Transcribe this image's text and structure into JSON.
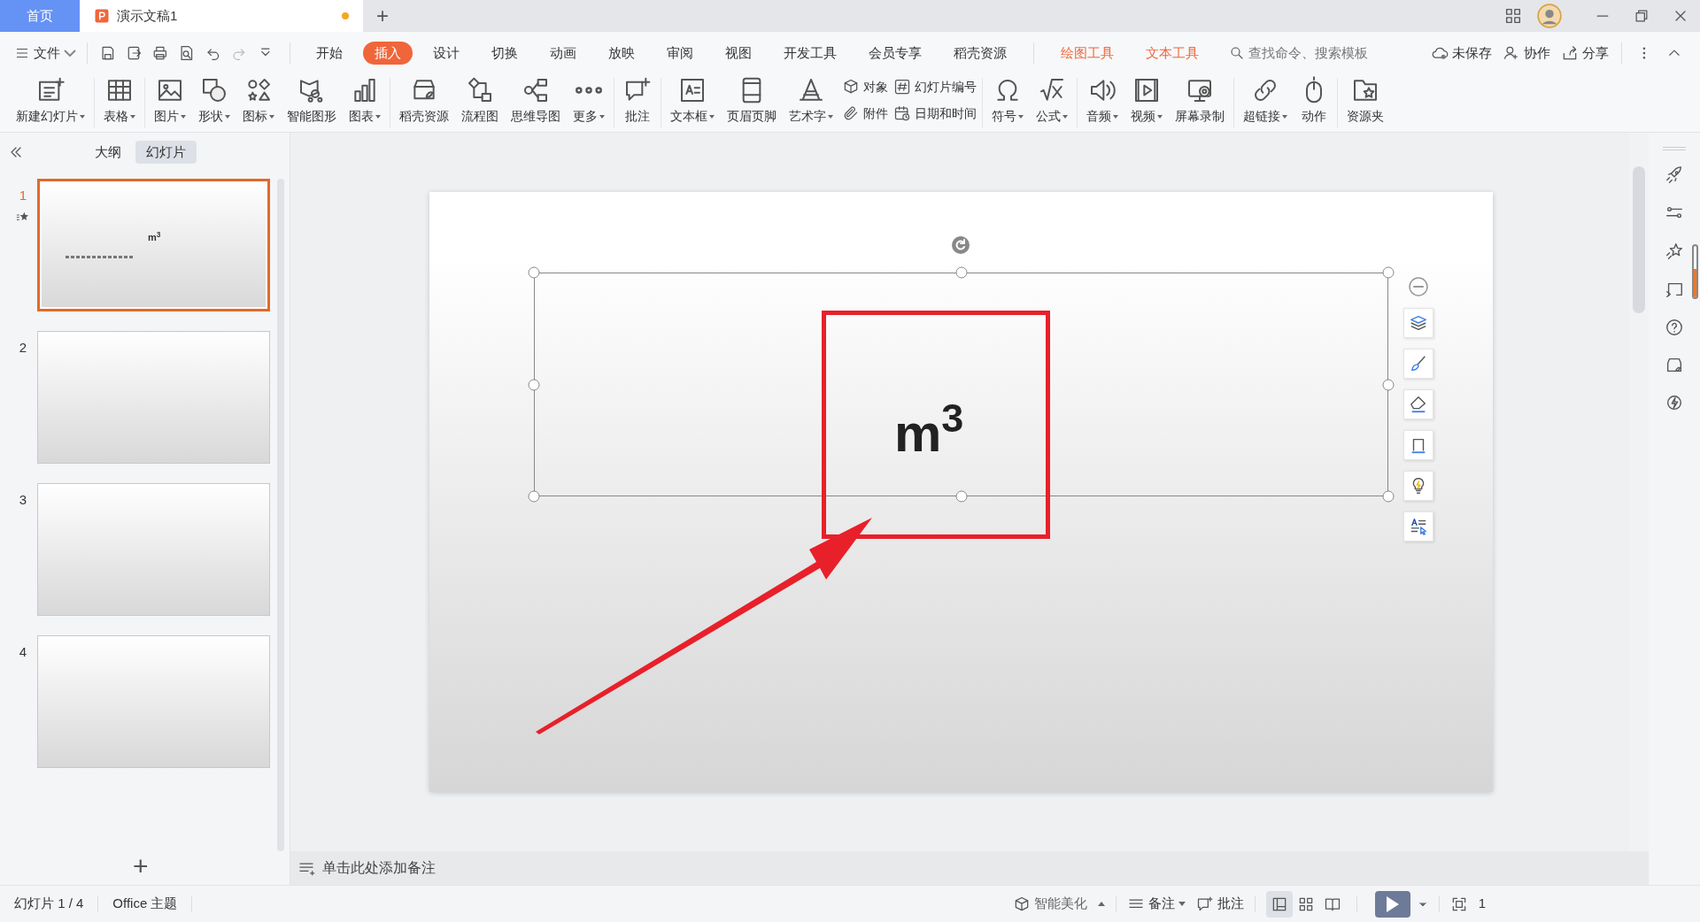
{
  "title_bar": {
    "home_tab": {
      "label": "首页",
      "selected": false
    },
    "doc_tab": {
      "label": "演示文稿1",
      "selected": true,
      "unsaved": true
    },
    "new_tab": "+"
  },
  "menu": {
    "file": "文件",
    "tabs": [
      {
        "label": "开始",
        "selected": false,
        "kind": "main"
      },
      {
        "label": "插入",
        "selected": true,
        "kind": "main"
      },
      {
        "label": "设计",
        "selected": false,
        "kind": "main"
      },
      {
        "label": "切换",
        "selected": false,
        "kind": "main"
      },
      {
        "label": "动画",
        "selected": false,
        "kind": "main"
      },
      {
        "label": "放映",
        "selected": false,
        "kind": "main"
      },
      {
        "label": "审阅",
        "selected": false,
        "kind": "main"
      },
      {
        "label": "视图",
        "selected": false,
        "kind": "main"
      },
      {
        "label": "开发工具",
        "selected": false,
        "kind": "main"
      },
      {
        "label": "会员专享",
        "selected": false,
        "kind": "main"
      },
      {
        "label": "稻壳资源",
        "selected": false,
        "kind": "main"
      },
      {
        "label": "绘图工具",
        "selected": false,
        "kind": "context"
      },
      {
        "label": "文本工具",
        "selected": false,
        "kind": "context"
      }
    ],
    "search": {
      "placeholder": "查找命令、搜索模板"
    },
    "actions": [
      "未保存",
      "协作",
      "分享"
    ]
  },
  "ribbon": [
    [
      {
        "label": "新建幻灯片",
        "dropdown": true,
        "kind": "large"
      }
    ],
    [
      {
        "label": "表格",
        "dropdown": true,
        "kind": "large"
      }
    ],
    [
      {
        "label": "图片",
        "dropdown": true,
        "kind": "large"
      },
      {
        "label": "形状",
        "dropdown": true,
        "kind": "large"
      },
      {
        "label": "图标",
        "dropdown": true,
        "kind": "large"
      },
      {
        "label": "智能图形",
        "dropdown": false,
        "kind": "large"
      },
      {
        "label": "图表",
        "dropdown": true,
        "kind": "large"
      }
    ],
    [
      {
        "label": "稻壳资源",
        "dropdown": false,
        "kind": "large"
      },
      {
        "label": "流程图",
        "dropdown": false,
        "kind": "large"
      },
      {
        "label": "思维导图",
        "dropdown": false,
        "kind": "large"
      },
      {
        "label": "更多",
        "dropdown": true,
        "kind": "large"
      }
    ],
    [
      {
        "label": "批注",
        "dropdown": false,
        "kind": "large"
      }
    ],
    [
      {
        "label": "文本框",
        "dropdown": true,
        "kind": "large"
      },
      {
        "label": "页眉页脚",
        "dropdown": false,
        "kind": "large"
      },
      {
        "label": "艺术字",
        "dropdown": true,
        "kind": "large"
      },
      {
        "label": "对象",
        "dropdown": false,
        "kind": "small"
      },
      {
        "label": "附件",
        "dropdown": false,
        "kind": "small"
      },
      {
        "label": "幻灯片编号",
        "dropdown": false,
        "kind": "small"
      },
      {
        "label": "日期和时间",
        "dropdown": false,
        "kind": "small"
      }
    ],
    [
      {
        "label": "符号",
        "dropdown": true,
        "kind": "large"
      },
      {
        "label": "公式",
        "dropdown": true,
        "kind": "large"
      }
    ],
    [
      {
        "label": "音频",
        "dropdown": true,
        "kind": "large"
      },
      {
        "label": "视频",
        "dropdown": true,
        "kind": "large"
      },
      {
        "label": "屏幕录制",
        "dropdown": false,
        "kind": "large"
      }
    ],
    [
      {
        "label": "超链接",
        "dropdown": true,
        "kind": "large"
      },
      {
        "label": "动作",
        "dropdown": false,
        "kind": "large"
      }
    ],
    [
      {
        "label": "资源夹",
        "dropdown": false,
        "kind": "large"
      }
    ]
  ],
  "left_panel": {
    "tabs": [
      {
        "label": "大纲",
        "selected": false
      },
      {
        "label": "幻灯片",
        "selected": true
      }
    ],
    "slides": [
      {
        "number": "1",
        "selected": true,
        "has_content": true,
        "content": "m$^{3}$"
      },
      {
        "number": "2",
        "selected": false,
        "has_content": false
      },
      {
        "number": "3",
        "selected": false,
        "has_content": false
      },
      {
        "number": "4",
        "selected": false,
        "has_content": false
      }
    ],
    "add": "+"
  },
  "slide": {
    "text": "m$^{3}$",
    "selected_box": true,
    "highlight_box": true,
    "arrow": true
  },
  "notes": {
    "placeholder": "单击此处添加备注"
  },
  "status_bar": {
    "slide_info": "幻灯片 1 / 4",
    "theme": "Office 主题",
    "beautify": "智能美化",
    "notes": "备注",
    "comments": "批注",
    "views": [
      {
        "selected": true
      },
      {
        "selected": false
      },
      {
        "selected": false
      }
    ],
    "zoom": "1"
  }
}
